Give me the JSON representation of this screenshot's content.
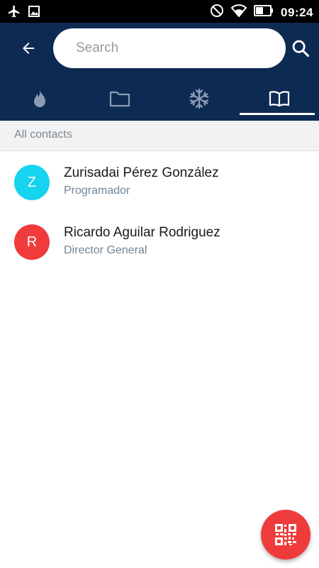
{
  "status_bar": {
    "time": "09:24",
    "icons": [
      "airplane-icon",
      "image-icon",
      "do-not-disturb-icon",
      "wifi-icon",
      "battery-icon"
    ]
  },
  "app_bar": {
    "back_icon": "arrow-back-icon",
    "search": {
      "placeholder": "Search",
      "value": ""
    },
    "search_icon": "search-icon",
    "tabs": [
      {
        "icon": "flame-icon",
        "active": false
      },
      {
        "icon": "folder-icon",
        "active": false
      },
      {
        "icon": "snowflake-icon",
        "active": false
      },
      {
        "icon": "book-icon",
        "active": true
      }
    ],
    "background_color": "#0d2a52"
  },
  "section": {
    "header": "All contacts"
  },
  "contacts": [
    {
      "initial": "Z",
      "name": "Zurisadai Pérez González",
      "role": "Programador",
      "color": "#16d3f0"
    },
    {
      "initial": "R",
      "name": "Ricardo Aguilar Rodriguez",
      "role": "Director General",
      "color": "#ef3b3b"
    }
  ],
  "fab": {
    "icon": "qr-code-icon",
    "color": "#ef3b3b"
  }
}
